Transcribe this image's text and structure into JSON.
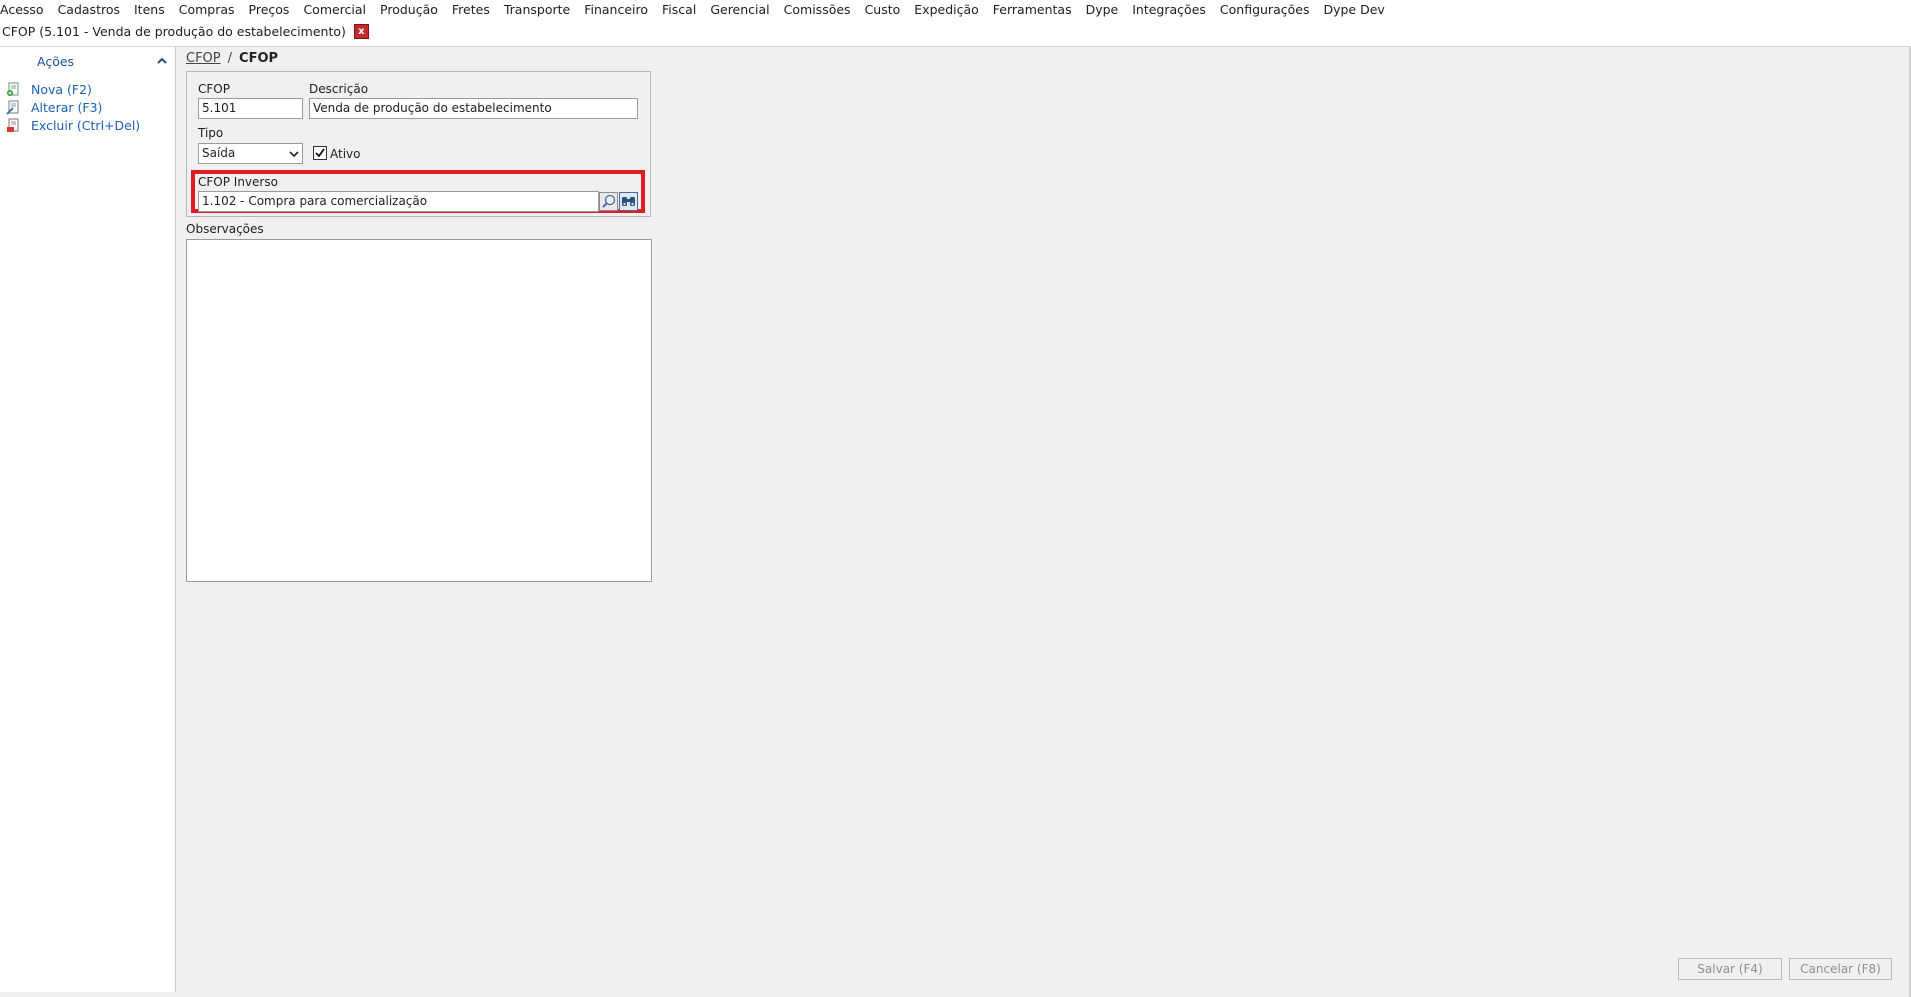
{
  "menu": {
    "items": [
      "Acesso",
      "Cadastros",
      "Itens",
      "Compras",
      "Preços",
      "Comercial",
      "Produção",
      "Fretes",
      "Transporte",
      "Financeiro",
      "Fiscal",
      "Gerencial",
      "Comissões",
      "Custo",
      "Expedição",
      "Ferramentas",
      "Dype",
      "Integrações",
      "Configurações",
      "Dype Dev"
    ]
  },
  "tab": {
    "title": "CFOP (5.101 - Venda de produção do estabelecimento)",
    "close_label": "x"
  },
  "sidebar": {
    "title": "Ações",
    "actions": [
      {
        "label": "Nova (F2)",
        "icon": "new-document-icon"
      },
      {
        "label": "Alterar (F3)",
        "icon": "edit-document-icon"
      },
      {
        "label": "Excluir (Ctrl+Del)",
        "icon": "delete-document-icon"
      }
    ]
  },
  "breadcrumb": {
    "link": "CFOP",
    "separator": "/",
    "current": "CFOP"
  },
  "form": {
    "cfop_label": "CFOP",
    "cfop_value": "5.101",
    "descricao_label": "Descrição",
    "descricao_value": "Venda de produção do estabelecimento",
    "tipo_label": "Tipo",
    "tipo_value": "Saída",
    "ativo_label": "Ativo",
    "ativo_checked": true,
    "cfop_inverso_label": "CFOP Inverso",
    "cfop_inverso_value": "1.102 - Compra para comercialização",
    "observacoes_label": "Observações",
    "observacoes_value": ""
  },
  "buttons": {
    "save_label": "Salvar (F4)",
    "cancel_label": "Cancelar (F8)"
  },
  "colors": {
    "highlight": "#e01b24",
    "link": "#1b5fb8",
    "close": "#c42b2b"
  }
}
